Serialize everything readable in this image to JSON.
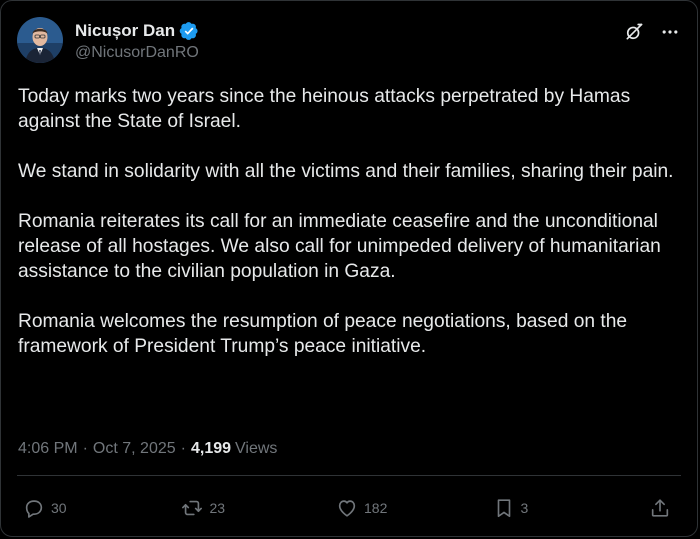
{
  "author": {
    "display_name": "Nicușor Dan",
    "handle": "@NicusorDanRO"
  },
  "tweet": {
    "paragraphs": [
      "Today marks two years since the heinous attacks perpetrated by Hamas against the State of Israel.",
      "We stand in solidarity with all the victims and their families, sharing their pain.",
      "Romania reiterates its call for an immediate ceasefire and the unconditional release of all hostages. We also call for unimpeded delivery of humanitarian assistance to the civilian population in Gaza.",
      "Romania welcomes the resumption of peace negotiations, based on the framework of President Trump’s peace initiative."
    ],
    "time": "4:06 PM",
    "separator": "·",
    "date": "Oct 7, 2025",
    "views_count": "4,199",
    "views_label": "Views"
  },
  "actions": {
    "replies": "30",
    "reposts": "23",
    "likes": "182",
    "bookmarks": "3"
  },
  "colors": {
    "background": "#000000",
    "text_primary": "#e7e9ea",
    "text_secondary": "#71767b",
    "border": "#2f3336",
    "verified_badge": "#1d9bf0"
  },
  "icons": {
    "verified": "verified-badge-icon",
    "grok": "grok-icon",
    "more": "more-icon",
    "reply": "reply-icon",
    "repost": "repost-icon",
    "like": "like-icon",
    "bookmark": "bookmark-icon",
    "share": "share-icon"
  }
}
